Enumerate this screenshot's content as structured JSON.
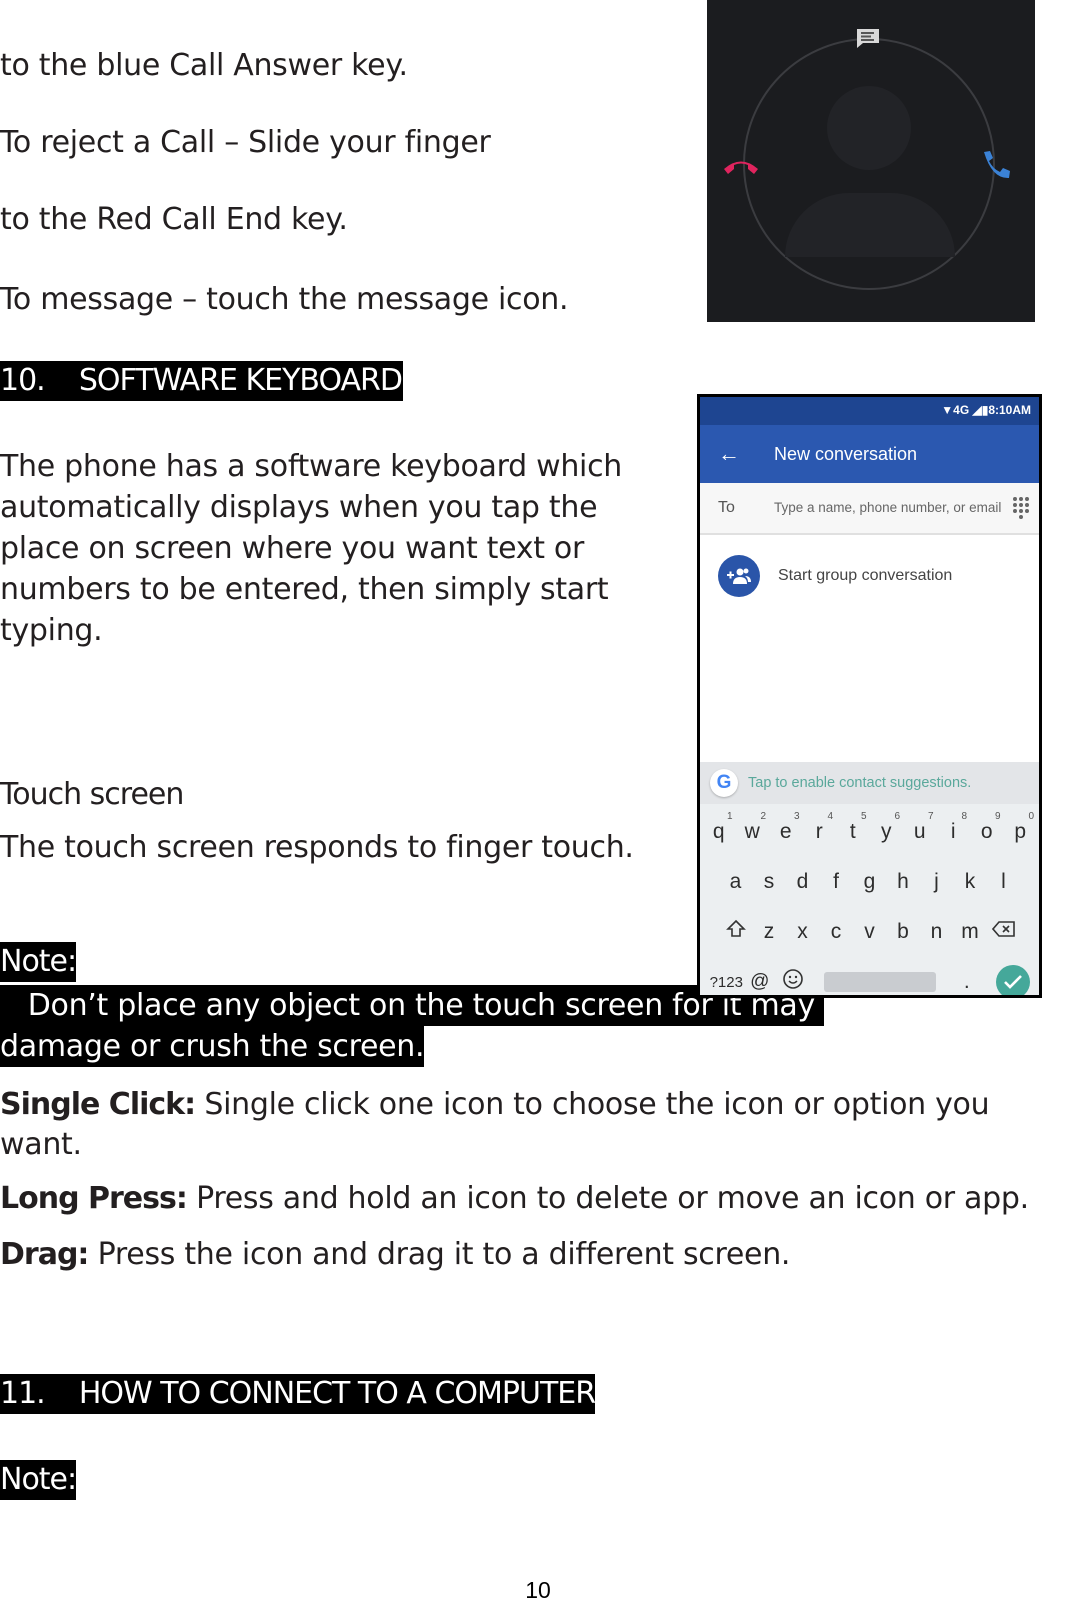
{
  "intro_lines": [
    "to the blue Call Answer key.",
    "To reject a Call – Slide your finger",
    "to the Red Call End key.",
    "To message – touch the message icon."
  ],
  "section10": {
    "heading": "10.    SOFTWARE KEYBOARD",
    "body_lines": [
      "The phone has a software keyboard which",
      "automatically displays when you tap the",
      "place on screen where you want text or",
      "numbers to be entered, then simply start",
      "typing."
    ]
  },
  "touch_screen": {
    "heading": "Touch screen",
    "body": "The touch screen responds to finger touch."
  },
  "note1": {
    "label": "Note:",
    "line1": "   Don’t place any object on the touch screen for it may ",
    "line2": "damage or crush the screen."
  },
  "gestures": [
    {
      "label": "Single Click:",
      "text": " Single click one icon to choose the icon or option you",
      "text2": "want."
    },
    {
      "label": "Long Press:",
      "text": " Press and hold an icon to delete or move an icon or app."
    },
    {
      "label": "Drag:",
      "text": " Press the icon and drag it to a different screen."
    }
  ],
  "section11": {
    "number": "11.    ",
    "title": "HOW TO CONNECT TO A COMPUTER"
  },
  "note2": {
    "label": "Note:"
  },
  "page_number": "10",
  "call_screen": {
    "icons": [
      "message-icon",
      "decline-call-icon",
      "answer-call-icon",
      "contact-avatar-icon"
    ],
    "colors": {
      "background": "#1b1c1f",
      "decline": "#e0245e",
      "answer": "#3b82d6"
    }
  },
  "phone": {
    "status": "▼4G ◢▮8:10AM",
    "title": "New conversation",
    "to_label": "To",
    "to_placeholder": "Type a name, phone number, or email",
    "group_label": "Start group conversation",
    "suggestion": "Tap to enable contact suggestions.",
    "google_letter": "G",
    "keyboard": {
      "row1": [
        {
          "k": "q",
          "n": "1"
        },
        {
          "k": "w",
          "n": "2"
        },
        {
          "k": "e",
          "n": "3"
        },
        {
          "k": "r",
          "n": "4"
        },
        {
          "k": "t",
          "n": "5"
        },
        {
          "k": "y",
          "n": "6"
        },
        {
          "k": "u",
          "n": "7"
        },
        {
          "k": "i",
          "n": "8"
        },
        {
          "k": "o",
          "n": "9"
        },
        {
          "k": "p",
          "n": "0"
        }
      ],
      "row2": [
        "a",
        "s",
        "d",
        "f",
        "g",
        "h",
        "j",
        "k",
        "l"
      ],
      "row3": [
        "z",
        "x",
        "c",
        "v",
        "b",
        "n",
        "m"
      ],
      "symbols_key": "?123",
      "at_key": "@",
      "period_key": "."
    },
    "colors": {
      "statusbar": "#1e4591",
      "appbar": "#2b58b0",
      "accent": "#45a89a"
    }
  }
}
